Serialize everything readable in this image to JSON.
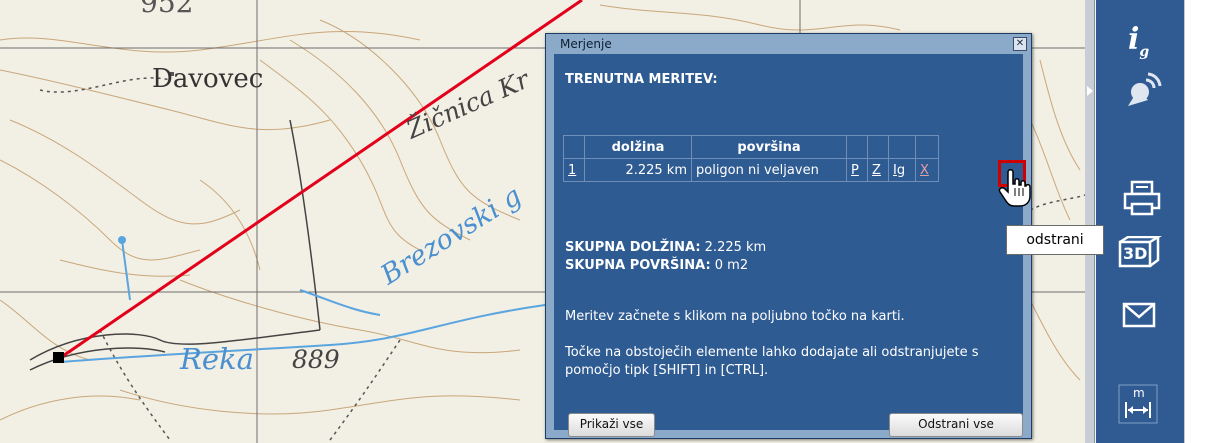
{
  "map": {
    "labels": {
      "place": "Davovec",
      "elevation_top": "952",
      "stream_a": "Žičnica Kr",
      "stream_b": "Brezovski g",
      "river": "Reka",
      "elevation_bottom": "889"
    },
    "measure_line_color": "#e3001b"
  },
  "dialog": {
    "title": "Merjenje",
    "heading": "TRENUTNA MERITEV:",
    "table": {
      "headers": [
        "",
        "dolžina",
        "površina",
        "",
        "",
        "",
        ""
      ],
      "rows": [
        {
          "index": "1",
          "length": "2.225 km",
          "area": "poligon ni veljaven",
          "p": "P",
          "z": "Z",
          "ig": "Ig",
          "remove": "X"
        }
      ]
    },
    "totals": {
      "length_label": "SKUPNA DOLŽINA:",
      "length_value": " 2.225 km",
      "area_label": "SKUPNA POVRŠINA:",
      "area_value": " 0 m2"
    },
    "hint1": "Meritev začnete s klikom na poljubno točko na karti.",
    "hint2": "Točke na obstoječih elemente lahko dodajate ali odstranjujete s pomočjo tipk [SHIFT] in [CTRL].",
    "buttons": {
      "show_all": "Prikaži vse",
      "remove_all": "Odstrani vse"
    }
  },
  "tooltip": "odstrani",
  "toolbar": {
    "icons": [
      "ig-icon",
      "satellite-icon",
      "printer-icon",
      "3d-icon",
      "envelope-icon",
      "measure-icon"
    ],
    "label_3d": "3D",
    "label_m": "m",
    "ig_label": "i",
    "ig_sub": "g"
  },
  "colors": {
    "toolbar_bg": "#2f5a92",
    "dialog_bg": "#2f5b93",
    "highlight": "#d10000"
  }
}
